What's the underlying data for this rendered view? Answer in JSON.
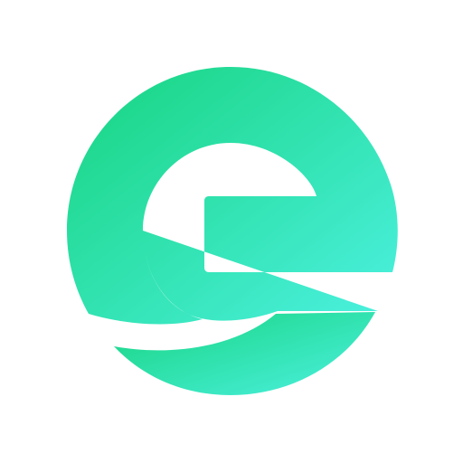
{
  "logo": {
    "name": "e-logo",
    "icon": "letter-e-circle-icon",
    "colors": {
      "background": "#ffffff",
      "gradient_start": "#17d47f",
      "gradient_end": "#4cf1e1"
    }
  }
}
